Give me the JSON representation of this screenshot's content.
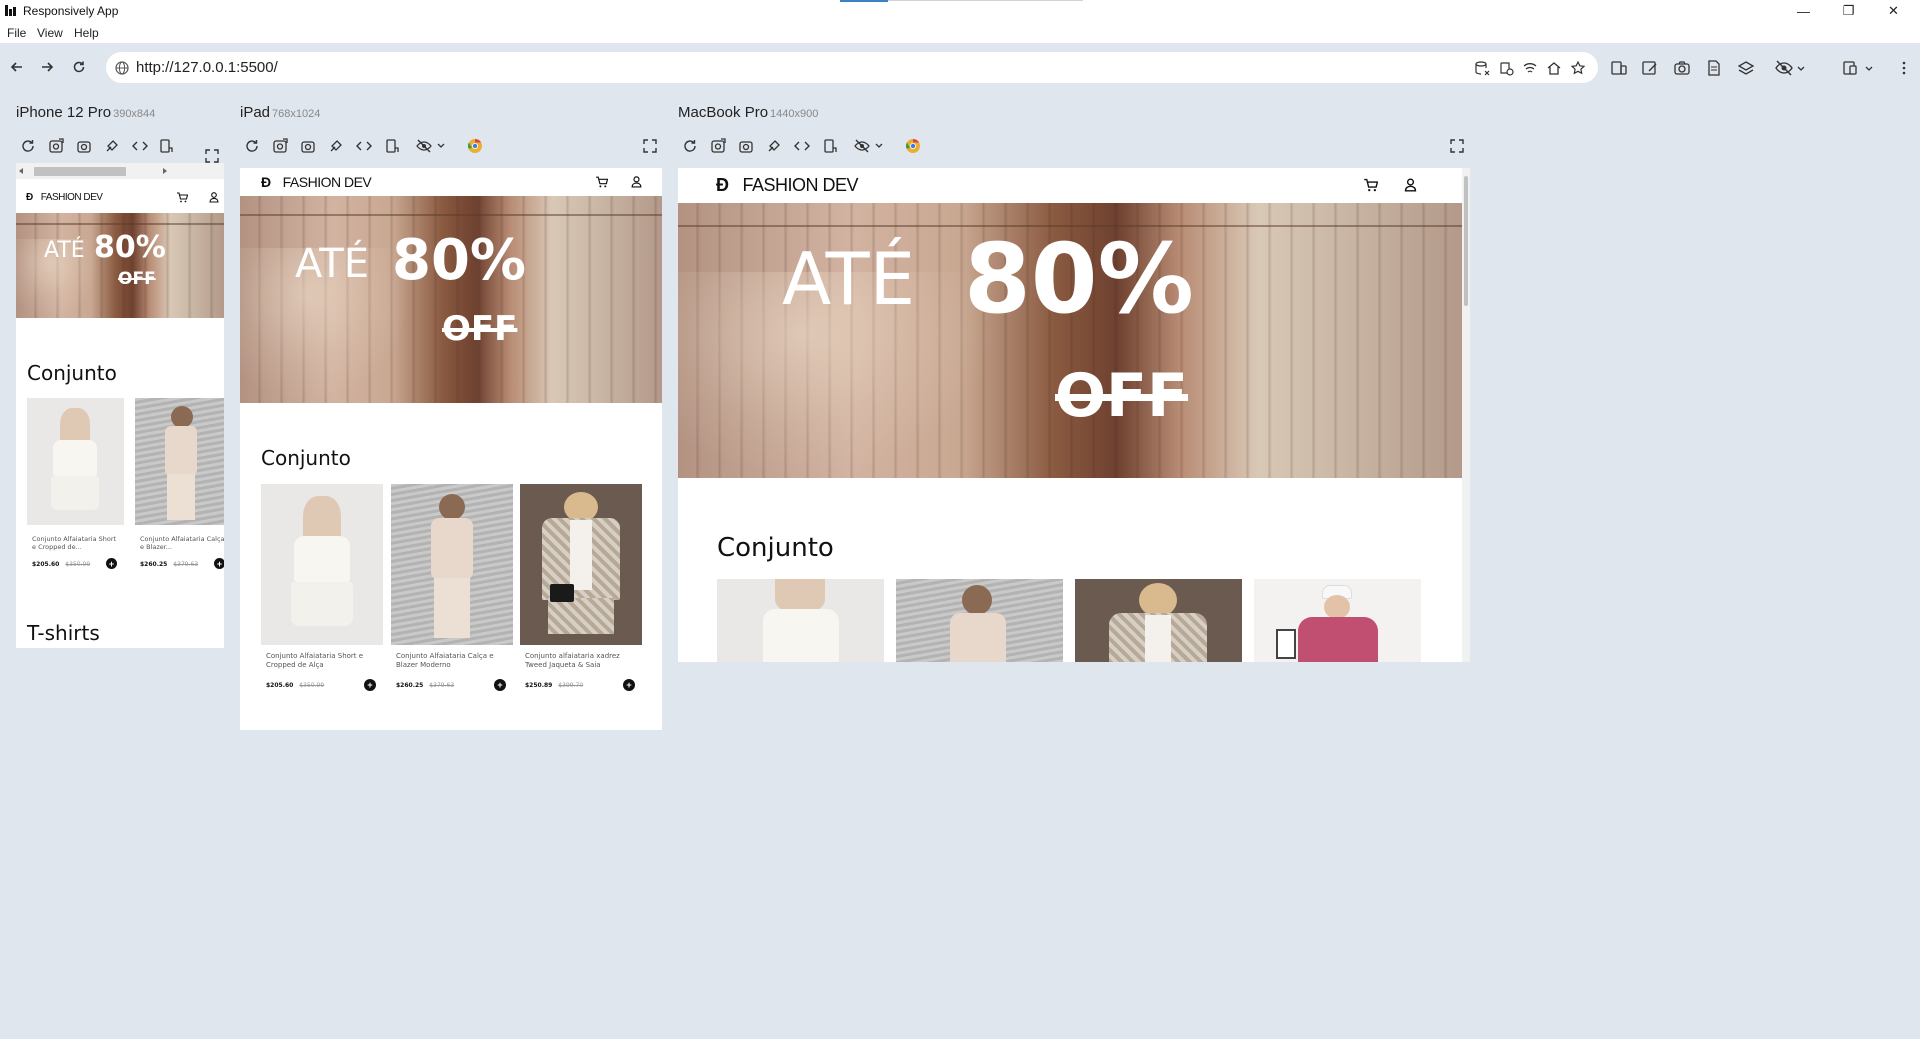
{
  "window": {
    "title": "Responsively App",
    "minimize": "—",
    "maximize": "❐",
    "close": "✕"
  },
  "menu": [
    "File",
    "View",
    "Help"
  ],
  "address": {
    "url": "http://127.0.0.1:5500/"
  },
  "devices": [
    {
      "name": "iPhone 12 Pro",
      "dims": "390x844"
    },
    {
      "name": "iPad",
      "dims": "768x1024"
    },
    {
      "name": "MacBook Pro",
      "dims": "1440x900"
    }
  ],
  "site": {
    "brand": "FASHION DEV",
    "hero": {
      "line1": "ATÉ",
      "line2": "80%",
      "line3": "OFF"
    },
    "sections": [
      "Conjunto",
      "T-shirts"
    ],
    "products": [
      {
        "name_short": "Conjunto Alfaiataria Short e Cropped de...",
        "name": "Conjunto Alfaiataria Short e Cropped de Alça",
        "price": "$205.60",
        "old": "$350.99"
      },
      {
        "name_short": "Conjunto Alfaiataria Calça e Blazer...",
        "name": "Conjunto Alfaiataria Calça e Blazer Moderno",
        "price": "$260.25",
        "old": "$379.63"
      },
      {
        "name": "Conjunto alfaiataria xadrez Tweed Jaqueta & Saia",
        "price": "$250.89",
        "old": "$399.70"
      }
    ],
    "plus": "+"
  },
  "colors": {
    "background": "#e0e6ee",
    "chrome": "#ffffff",
    "accent": "#3b82c4"
  }
}
